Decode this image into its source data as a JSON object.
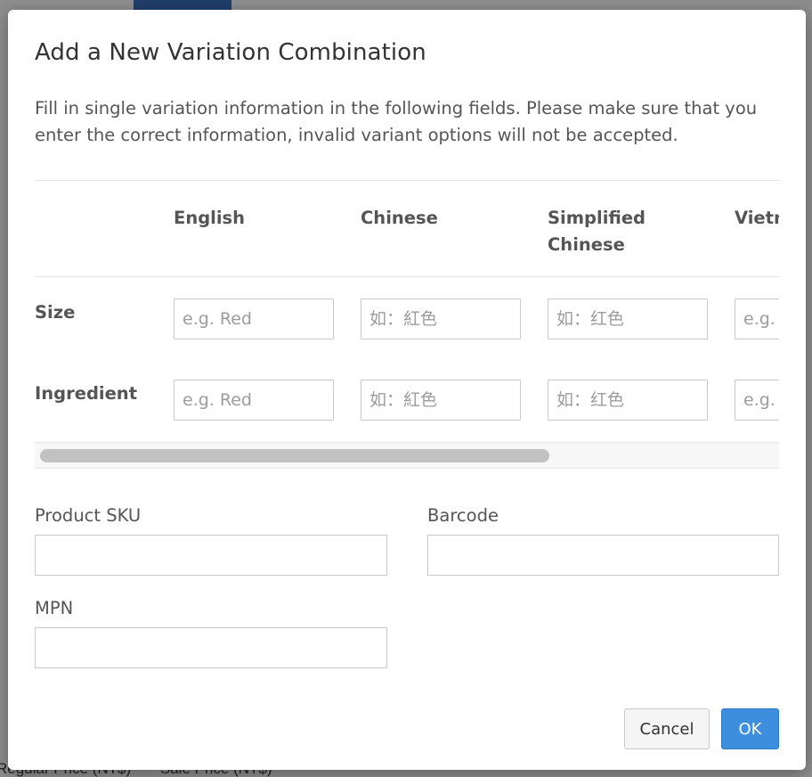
{
  "background": {
    "bottom_labels": [
      "Regular Price (NT$)",
      "Sale Price (NT$)"
    ]
  },
  "modal": {
    "title": "Add a New Variation Combination",
    "description": "Fill in single variation information in the following fields. Please make sure that you enter the correct information, invalid variant options will not be accepted."
  },
  "variation_table": {
    "columns": [
      "English",
      "Chinese",
      "Simplified Chinese",
      "Vietnamese"
    ],
    "rows": [
      {
        "label": "Size",
        "placeholders": [
          "e.g. Red",
          "如：紅色",
          "如：红色",
          "e.g. Red"
        ]
      },
      {
        "label": "Ingredient",
        "placeholders": [
          "e.g. Red",
          "如：紅色",
          "如：红色",
          "e.g. Red"
        ]
      }
    ]
  },
  "fields": {
    "sku_label": "Product SKU",
    "sku_value": "",
    "barcode_label": "Barcode",
    "barcode_value": "",
    "mpn_label": "MPN",
    "mpn_value": ""
  },
  "buttons": {
    "cancel": "Cancel",
    "ok": "OK"
  },
  "colors": {
    "primary": "#3d8fde",
    "text": "#555555",
    "title": "#333333",
    "border": "#c9c9c9"
  }
}
